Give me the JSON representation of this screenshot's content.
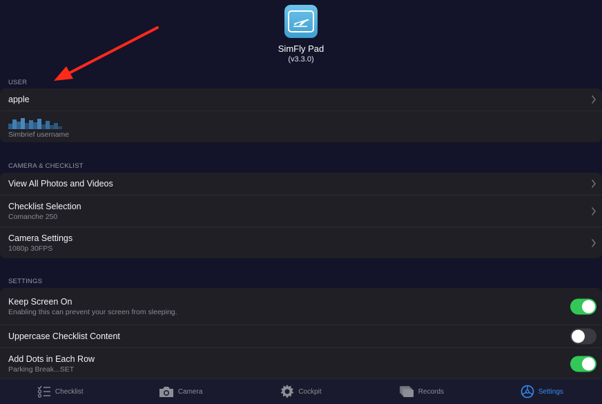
{
  "app": {
    "name": "SimFly Pad",
    "version": "(v3.3.0)",
    "icon": "airplane-departure-icon"
  },
  "sections": {
    "user": {
      "label": "USER",
      "rows": [
        {
          "title": "apple"
        },
        {
          "subtitle": "Simbrief username"
        }
      ]
    },
    "camera": {
      "label": "CAMERA & CHECKLIST",
      "rows": [
        {
          "title": "View All Photos and Videos"
        },
        {
          "title": "Checklist Selection",
          "subtitle": "Comanche 250"
        },
        {
          "title": "Camera Settings",
          "subtitle": "1080p 30FPS"
        }
      ]
    },
    "settings": {
      "label": "SETTINGS",
      "rows": [
        {
          "title": "Keep Screen On",
          "subtitle": "Enabling this can prevent your screen from sleeping.",
          "toggle_on": true
        },
        {
          "title": "Uppercase Checklist Content",
          "toggle_on": false
        },
        {
          "title": "Add Dots in Each Row",
          "subtitle": "Parking Break...SET",
          "toggle_on": true
        }
      ]
    }
  },
  "tabs": [
    {
      "label": "Checklist",
      "icon": "checklist-icon",
      "active": false
    },
    {
      "label": "Camera",
      "icon": "camera-icon",
      "active": false
    },
    {
      "label": "Cockpit",
      "icon": "gear-icon",
      "active": false
    },
    {
      "label": "Records",
      "icon": "records-stack-icon",
      "active": false
    },
    {
      "label": "Settings",
      "icon": "steering-wheel-icon",
      "active": true
    }
  ],
  "colors": {
    "background": "#13132a",
    "cell": "#1f1f25",
    "toggle_on": "#33c759",
    "toggle_off": "#3a3a40",
    "tab_active": "#2f8ff6",
    "annotation_arrow": "#ff2a1a"
  }
}
